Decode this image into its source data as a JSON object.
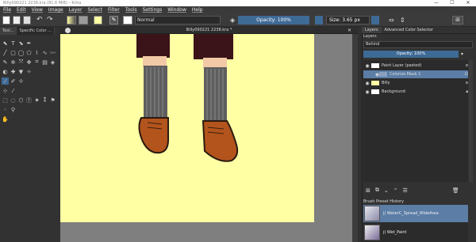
{
  "window": {
    "title": "Billy090221 2238.kra (81.6 MiB) – Krita",
    "min": "—",
    "max": "☐",
    "close": "✕"
  },
  "menu": [
    "File",
    "Edit",
    "View",
    "Image",
    "Layer",
    "Select",
    "Filter",
    "Tools",
    "Settings",
    "Window",
    "Help"
  ],
  "toolbar": {
    "blend_mode": "Normal",
    "opacity": "Opacity: 100%",
    "size": "Size: 3.65 px"
  },
  "left_tabs": [
    "Tool...",
    "Specific Color ..."
  ],
  "document": {
    "tab_title": "Billy090221 2238.kra *"
  },
  "right_tabs": [
    "Layers",
    "Advanced Color Selector"
  ],
  "layers_panel": {
    "title": "Layers",
    "blend_mode": "Behind",
    "opacity": "Opacity: 100%",
    "layers": [
      {
        "name": "Paint Layer (pasted)",
        "selected": false
      },
      {
        "name": "Colorize Mask 1",
        "selected": true
      },
      {
        "name": "Billy",
        "selected": false
      },
      {
        "name": "Background",
        "selected": false
      }
    ]
  },
  "brush_history": {
    "title": "Brush Preset History",
    "items": [
      {
        "name": "j) WaterC_Spread_WideArea",
        "selected": true
      },
      {
        "name": "j) Wet_Paint",
        "selected": false
      }
    ]
  },
  "colors": {
    "accent": "#3e6a96",
    "canvas": "#ffffa4",
    "selected_row": "#5b7da6"
  }
}
